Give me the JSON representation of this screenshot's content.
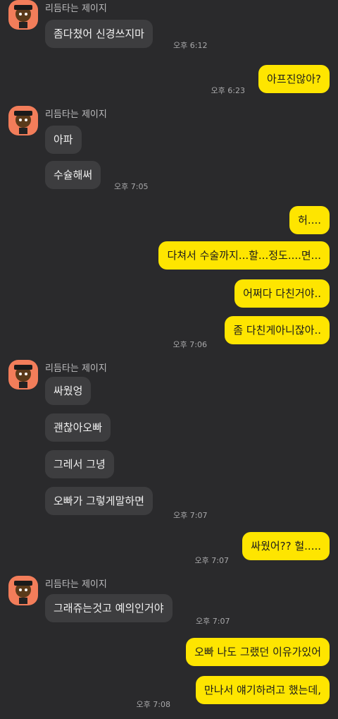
{
  "chat": {
    "sender_name": "리듬타는 제이지",
    "blocks": [
      {
        "type": "incoming",
        "messages": [
          "좀다쳤어 신경쓰지마"
        ],
        "time": "오후 6:12"
      },
      {
        "type": "outgoing",
        "messages": [
          "아프진않아?"
        ],
        "time": "오후 6:23"
      },
      {
        "type": "incoming",
        "messages": [
          "아파",
          "수슐해써"
        ],
        "time": "오후 7:05"
      },
      {
        "type": "outgoing",
        "messages": [
          "허....",
          "다쳐서 수술까지...할...정도....면...",
          "어쩌다 다친거야..",
          "좀 다친게아니잖아.."
        ],
        "time": "오후 7:06"
      },
      {
        "type": "incoming",
        "messages": [
          "싸웠엉",
          "괜찮아오빠",
          "그레서 그녕",
          "오빠가 그렇게말하면"
        ],
        "time": "오후 7:07"
      },
      {
        "type": "outgoing",
        "messages": [
          "싸웠어?? 헐....."
        ],
        "time": "오후 7:07"
      },
      {
        "type": "incoming",
        "messages": [
          "그래쥬는것고 예의인거야"
        ],
        "time": "오후 7:07"
      },
      {
        "type": "outgoing",
        "messages": [
          "오빠 나도 그랬던 이유가있어",
          "만나서 얘기하려고 했는데,"
        ],
        "time": "오후 7:08"
      }
    ]
  },
  "icons": {
    "avatar": "character-avatar-icon"
  },
  "colors": {
    "background": "#2a2a2c",
    "incoming_bubble": "#3d3d3f",
    "outgoing_bubble": "#fee500",
    "avatar_bg": "#f27d5a"
  }
}
